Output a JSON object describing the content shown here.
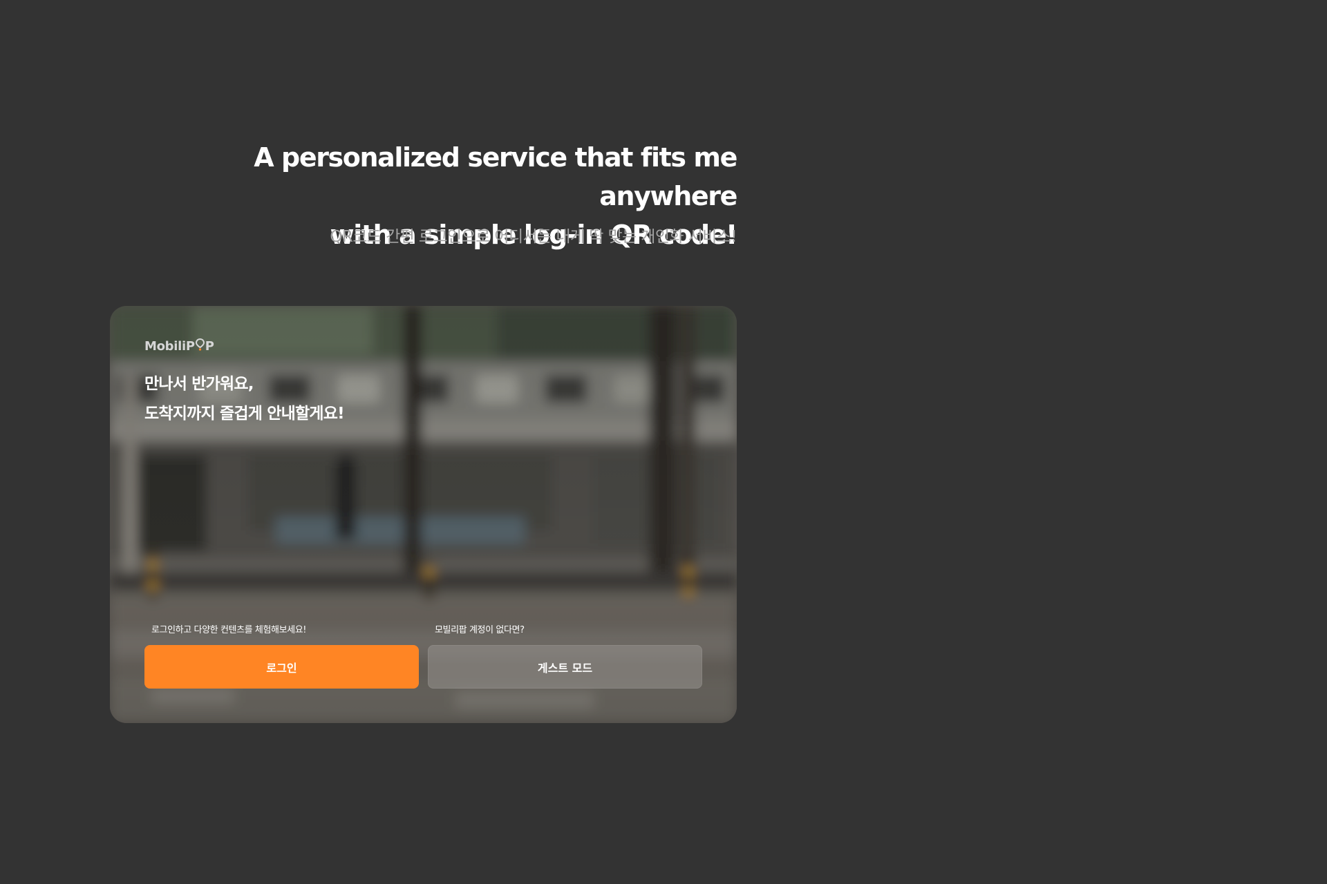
{
  "headline": {
    "line1": "A personalized service that fits me anywhere",
    "line2": "with a simple log-in QR code!"
  },
  "subtitle": "QR코드 간편 로그인으로 어디서든 내게 딱 맞는 개인화 서비스!",
  "card": {
    "logo": {
      "prefix": "MobiliP",
      "suffix": "P",
      "pin_icon": "location-pin-icon"
    },
    "welcome": {
      "line1": "만나서 반가워요,",
      "line2": "도착지까지 즐겁게 안내할게요!"
    },
    "login_hint": "로그인하고 다양한 컨텐츠를 체험해보세요!",
    "guest_hint": "모빌리팝 계정이 없다면?",
    "login_button": "로그인",
    "guest_button": "게스트 모드"
  },
  "colors": {
    "background": "#333333",
    "accent": "#ff8524",
    "subtitle": "#a3a3a3"
  }
}
